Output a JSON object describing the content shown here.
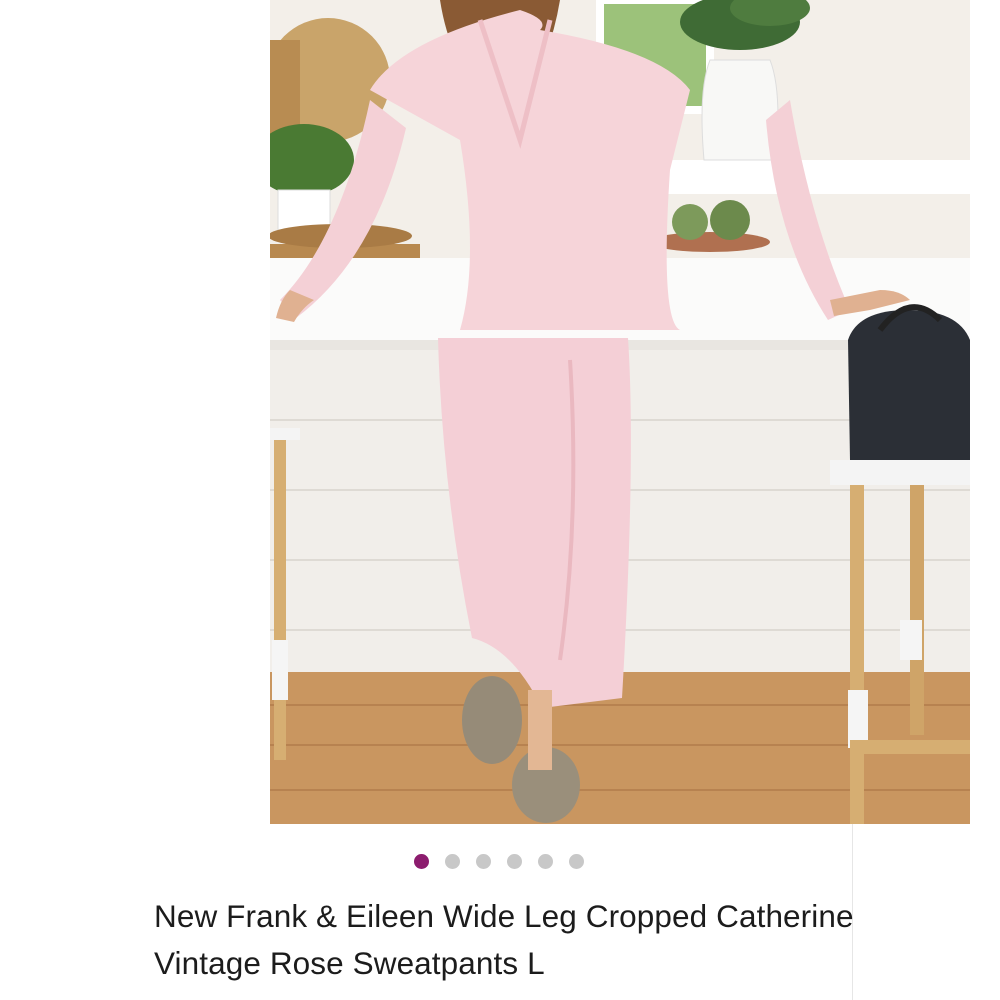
{
  "listing": {
    "title": "New Frank & Eileen Wide Leg Cropped Catherine Vintage Rose Sweatpants L",
    "image_count": 6,
    "active_image_index": 0
  },
  "colors": {
    "active_dot": "#8c1c6e",
    "inactive_dot": "#c8c8c8",
    "outfit_pink": "#f6d4d9",
    "floor_wood": "#c99660"
  }
}
